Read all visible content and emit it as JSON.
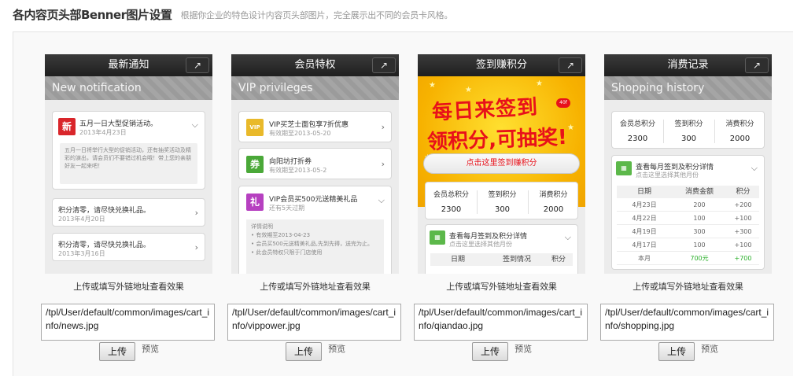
{
  "page": {
    "title": "各内容页头部Benner图片设置",
    "description": "根据你企业的特色设计内容页头部图片，完全展示出不同的会员卡风格。"
  },
  "card_caption": "上传或填写外链地址查看效果",
  "upload_label": "上传",
  "preview_label": "预览",
  "cards": [
    {
      "topbar": "最新通知",
      "banner": "New notification",
      "path": "/tpl/User/default/common/images/cart_info/news.jpg",
      "items": [
        {
          "icon": "新",
          "title": "五月一日大型促销活动。",
          "date": "2013年4月23日",
          "body": "五月一日将举行大型的促销活动，还有抽奖活动及精彩的演出，请会员们不要错过机会哦！带上您的亲朋好友一起来吧！"
        },
        {
          "title": "积分清零，请尽快兑换礼品。",
          "date": "2013年4月20日"
        },
        {
          "title": "积分清零，请尽快兑换礼品。",
          "date": "2013年3月16日"
        }
      ]
    },
    {
      "topbar": "会员特权",
      "banner": "VIP privileges",
      "path": "/tpl/User/default/common/images/cart_info/vippower.jpg",
      "items": [
        {
          "icon": "VIP",
          "color": "#e9b92a",
          "title": "VIP买芝士面包享7折优惠",
          "date": "有效期至2013-05-20"
        },
        {
          "icon": "券",
          "color": "#4aa838",
          "title": "向阳坊打折券",
          "date": "有效期至2013-05-2"
        },
        {
          "icon": "礼",
          "color": "#b640c0",
          "title": "VIP会员买500元送精美礼品",
          "date": "还有5天过期"
        }
      ],
      "detail": {
        "heading": "详情说明",
        "lines": [
          "• 有效期至2013-04-23",
          "• 会员买500元送精美礼品,先到先得，送完为止。",
          "• 此会员特权只限于门店使用"
        ]
      }
    },
    {
      "topbar": "签到赚积分",
      "promo_line1": "每日来签到",
      "promo_line2": "领积分,可抽奖!",
      "promo_badge": "40f",
      "checkin_button": "点击这里签到赚积分",
      "stats": [
        {
          "label": "会员总积分",
          "value": "2300"
        },
        {
          "label": "签到积分",
          "value": "300"
        },
        {
          "label": "消费积分",
          "value": "2000"
        }
      ],
      "detail_title": "查看每月签到及积分详情",
      "detail_sub": "点击这里选择其他月份",
      "table_headers": [
        "日期",
        "签到情况",
        "积分"
      ],
      "path": "/tpl/User/default/common/images/cart_info/qiandao.jpg"
    },
    {
      "topbar": "消费记录",
      "banner": "Shopping history",
      "stats": [
        {
          "label": "会员总积分",
          "value": "2300"
        },
        {
          "label": "签到积分",
          "value": "300"
        },
        {
          "label": "消费积分",
          "value": "2000"
        }
      ],
      "detail_title": "查看每月签到及积分详情",
      "detail_sub": "点击这里选择其他月份",
      "table_headers": [
        "日期",
        "消费金额",
        "积分"
      ],
      "rows": [
        [
          "4月23日",
          "200",
          "+200"
        ],
        [
          "4月22日",
          "100",
          "+100"
        ],
        [
          "4月19日",
          "300",
          "+300"
        ],
        [
          "4月17日",
          "100",
          "+100"
        ]
      ],
      "total": [
        "本月",
        "700元",
        "+700"
      ],
      "path": "/tpl/User/default/common/images/cart_info/shopping.jpg"
    }
  ],
  "colors": {
    "accent_red": "#e8111a",
    "total_green": "#2bb02b",
    "news_red": "#d9262b",
    "calendar_green": "#5cb84a"
  }
}
